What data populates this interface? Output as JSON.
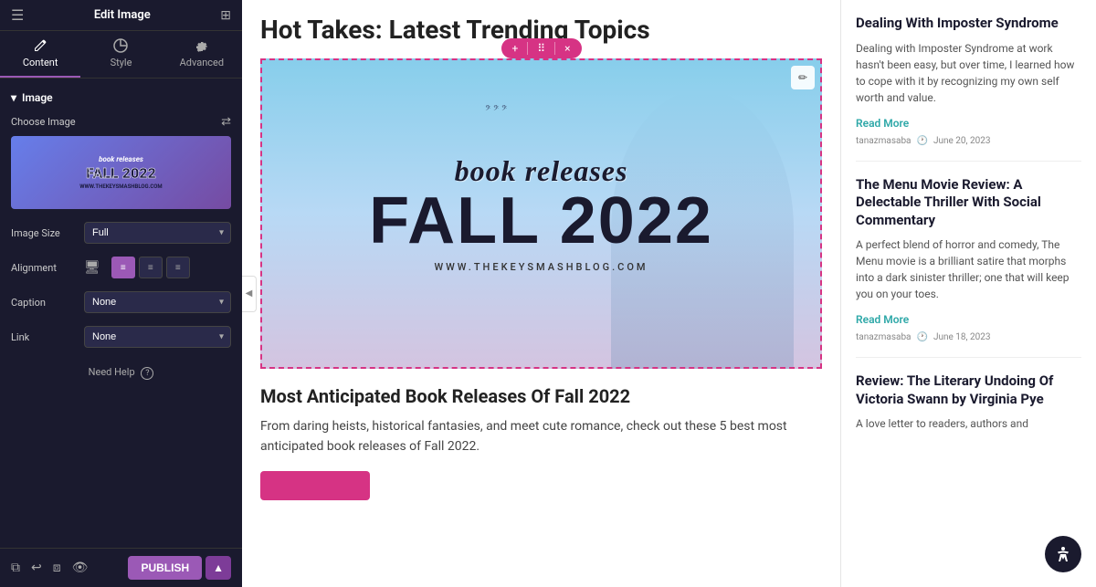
{
  "header": {
    "title": "Edit Image",
    "menu_icon": "☰",
    "grid_icon": "⊞"
  },
  "tabs": [
    {
      "id": "content",
      "label": "Content",
      "icon": "pencil",
      "active": true
    },
    {
      "id": "style",
      "label": "Style",
      "icon": "circle-half",
      "active": false
    },
    {
      "id": "advanced",
      "label": "Advanced",
      "icon": "gear",
      "active": false
    }
  ],
  "panel": {
    "image_section_title": "Image",
    "choose_image_label": "Choose Image",
    "image_size_label": "Image Size",
    "image_size_value": "Full",
    "alignment_label": "Alignment",
    "caption_label": "Caption",
    "caption_value": "None",
    "link_label": "Link",
    "link_value": "None",
    "need_help_label": "Need Help"
  },
  "toolbar": {
    "add_icon": "+",
    "move_icon": "⠿",
    "close_icon": "×"
  },
  "main_article": {
    "page_title": "Hot Takes: Latest Trending Topics",
    "featured_image_alt": "Book Releases Fall 2022",
    "banner_text1": "book releases",
    "banner_text2": "FALL 2022",
    "banner_url": "WWW.THEKEYSMASHBLOG.COM",
    "article_title": "Most Anticipated Book Releases Of Fall 2022",
    "article_text": "From daring heists, historical fantasies, and meet cute romance, check out these 5 best most anticipated book releases of Fall 2022."
  },
  "sidebar": {
    "articles": [
      {
        "title": "Dealing With Imposter Syndrome",
        "text": "Dealing with Imposter Syndrome at work hasn't been easy, but over time, I learned how to cope with it by recognizing my own self worth and value.",
        "read_more": "Read More",
        "author": "tanazmasaba",
        "date": "June 20, 2023"
      },
      {
        "title": "The Menu Movie Review: A Delectable Thriller With Social Commentary",
        "text": "A perfect blend of horror and comedy, The Menu movie is a brilliant satire that morphs into a dark sinister thriller; one that will keep you on your toes.",
        "read_more": "Read More",
        "author": "tanazmasaba",
        "date": "June 18, 2023"
      },
      {
        "title": "Review: The Literary Undoing Of Victoria Swann by Virginia Pye",
        "text": "A love letter to readers, authors and",
        "read_more": "",
        "author": "",
        "date": ""
      }
    ]
  },
  "footer": {
    "publish_label": "PUBLISH"
  }
}
